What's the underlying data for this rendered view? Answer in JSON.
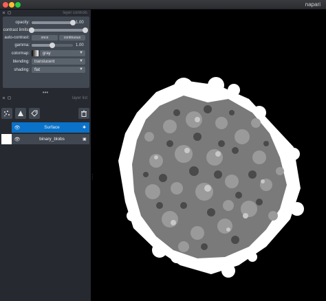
{
  "window": {
    "title": "napari"
  },
  "layer_controls": {
    "header_title": "layer controls",
    "opacity": {
      "label": "opacity:",
      "value": "1.00",
      "level": 1.0
    },
    "contrast_limits": {
      "label": "contrast limits:",
      "low": 0.0,
      "high": 1.0
    },
    "auto_contrast": {
      "label": "auto-contrast:",
      "once_label": "once",
      "continuous_label": "continuous"
    },
    "gamma": {
      "label": "gamma:",
      "value": "1.00",
      "level": 0.5
    },
    "colormap": {
      "label": "colormap:",
      "value": "gray"
    },
    "blending": {
      "label": "blending:",
      "value": "translucent"
    },
    "shading": {
      "label": "shading:",
      "value": "flat"
    }
  },
  "layer_list": {
    "header_title": "layer list",
    "layers": [
      {
        "name": "Surface",
        "selected": true,
        "visible": true,
        "type_icon": "surface-icon"
      },
      {
        "name": "binary_blobs",
        "selected": false,
        "visible": true,
        "type_icon": "image-icon"
      }
    ]
  },
  "colors": {
    "accent": "#0a72c9",
    "panel": "#262930",
    "widget": "#414851"
  }
}
